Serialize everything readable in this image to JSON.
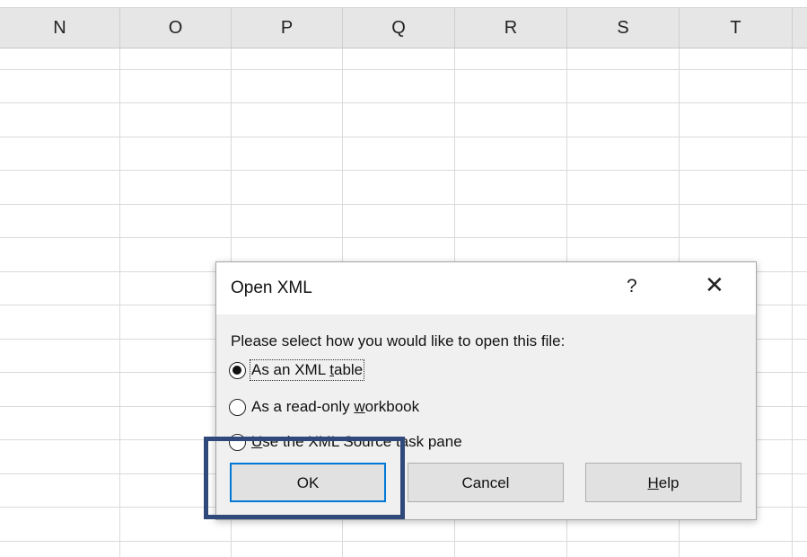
{
  "columns": [
    "N",
    "O",
    "P",
    "Q",
    "R",
    "S",
    "T"
  ],
  "dialog": {
    "title": "Open XML",
    "help_glyph": "?",
    "close_glyph": "✕",
    "prompt": "Please select how you would like to open this file:",
    "options": [
      {
        "pre": "As an XML ",
        "mnemonic": "t",
        "post": "able",
        "selected": true
      },
      {
        "pre": "As a read-only ",
        "mnemonic": "w",
        "post": "orkbook",
        "selected": false
      },
      {
        "pre": "",
        "mnemonic": "U",
        "post": "se the XML Source task pane",
        "selected": false
      }
    ],
    "buttons": {
      "ok": {
        "pre": "OK",
        "mnemonic": "",
        "post": ""
      },
      "cancel": {
        "pre": "Cancel",
        "mnemonic": "",
        "post": ""
      },
      "help": {
        "pre": "",
        "mnemonic": "H",
        "post": "elp"
      }
    }
  },
  "colors": {
    "accent": "#0078d7",
    "highlight": "#2f4a7a"
  }
}
